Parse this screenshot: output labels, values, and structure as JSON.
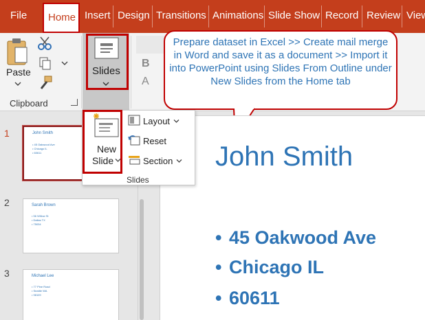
{
  "tabs": [
    "File",
    "Home",
    "Insert",
    "Design",
    "Transitions",
    "Animations",
    "Slide Show",
    "Record",
    "Review",
    "View"
  ],
  "ribbon": {
    "paste_label": "Paste",
    "clipboard_group": "Clipboard",
    "slides_button": "Slides",
    "bold_glyph": "B",
    "font_glyph": "A"
  },
  "callout": {
    "text": "Prepare dataset in Excel >> Create mail merge in Word and save it as a document >> Import it into PowerPoint using Slides From Outline under New Slides from the Home tab"
  },
  "dropdown": {
    "new_slide_line1": "New",
    "new_slide_line2": "Slide",
    "layout": "Layout",
    "reset": "Reset",
    "section": "Section",
    "group_label": "Slides"
  },
  "thumbnails": [
    {
      "num": "1",
      "title": "John Smith",
      "bullets": [
        "• 45 Oakwood Ave",
        "• Chicago IL",
        "• 60611"
      ]
    },
    {
      "num": "2",
      "title": "Sarah Brown",
      "bullets": [
        "• 56 Willow St",
        "• Dallas TX",
        "• 75034"
      ]
    },
    {
      "num": "3",
      "title": "Michael Lee",
      "bullets": [
        "• 77 Pine Road",
        "• Seattle WA",
        "• 98109"
      ]
    }
  ],
  "slide": {
    "title": "John Smith",
    "bullets": [
      "45 Oakwood Ave",
      "Chicago IL",
      "60611"
    ]
  },
  "colors": {
    "accent": "#c43e1c",
    "highlight": "#c00000",
    "text_blue": "#2e74b5"
  }
}
